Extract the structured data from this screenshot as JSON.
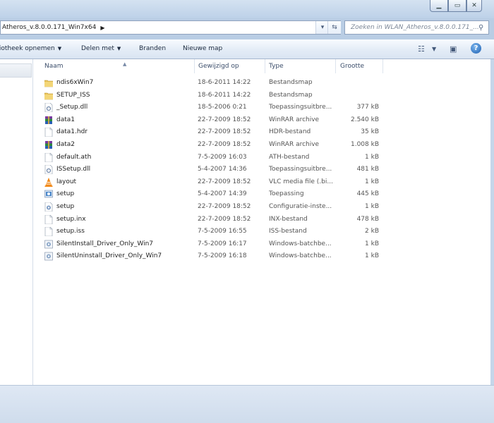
{
  "window": {
    "address_path": "Atheros_v.8.0.0.171_Win7x64",
    "search_placeholder": "Zoeken in WLAN_Atheros_v.8.0.0.171_..."
  },
  "toolbar": {
    "library": "Bibliotheek opnemen",
    "share": "Delen met",
    "burn": "Branden",
    "new_folder": "Nieuwe map",
    "help": "?"
  },
  "columns": {
    "name": "Naam",
    "date": "Gewijzigd op",
    "type": "Type",
    "size": "Grootte"
  },
  "files": [
    {
      "name": "ndis6xWin7",
      "date": "18-6-2011 14:22",
      "type": "Bestandsmap",
      "size": "",
      "icon": "folder-icon"
    },
    {
      "name": "SETUP_ISS",
      "date": "18-6-2011 14:22",
      "type": "Bestandsmap",
      "size": "",
      "icon": "folder-icon"
    },
    {
      "name": "_Setup.dll",
      "date": "18-5-2006 0:21",
      "type": "Toepassingsuitbre...",
      "size": "377 kB",
      "icon": "dll-icon"
    },
    {
      "name": "data1",
      "date": "22-7-2009 18:52",
      "type": "WinRAR archive",
      "size": "2.540 kB",
      "icon": "winrar-icon"
    },
    {
      "name": "data1.hdr",
      "date": "22-7-2009 18:52",
      "type": "HDR-bestand",
      "size": "35 kB",
      "icon": "file-icon"
    },
    {
      "name": "data2",
      "date": "22-7-2009 18:52",
      "type": "WinRAR archive",
      "size": "1.008 kB",
      "icon": "winrar-icon"
    },
    {
      "name": "default.ath",
      "date": "7-5-2009 16:03",
      "type": "ATH-bestand",
      "size": "1 kB",
      "icon": "file-icon"
    },
    {
      "name": "ISSetup.dll",
      "date": "5-4-2007 14:36",
      "type": "Toepassingsuitbre...",
      "size": "481 kB",
      "icon": "dll-icon"
    },
    {
      "name": "layout",
      "date": "22-7-2009 18:52",
      "type": "VLC media file (.bi...",
      "size": "1 kB",
      "icon": "vlc-icon"
    },
    {
      "name": "setup",
      "date": "5-4-2007 14:39",
      "type": "Toepassing",
      "size": "445 kB",
      "icon": "setup-icon"
    },
    {
      "name": "setup",
      "date": "22-7-2009 18:52",
      "type": "Configuratie-inste...",
      "size": "1 kB",
      "icon": "config-icon"
    },
    {
      "name": "setup.inx",
      "date": "22-7-2009 18:52",
      "type": "INX-bestand",
      "size": "478 kB",
      "icon": "file-icon"
    },
    {
      "name": "setup.iss",
      "date": "7-5-2009 16:55",
      "type": "ISS-bestand",
      "size": "2 kB",
      "icon": "file-icon"
    },
    {
      "name": "SilentInstall_Driver_Only_Win7",
      "date": "7-5-2009 16:17",
      "type": "Windows-batchbe...",
      "size": "1 kB",
      "icon": "batch-icon"
    },
    {
      "name": "SilentUninstall_Driver_Only_Win7",
      "date": "7-5-2009 16:18",
      "type": "Windows-batchbe...",
      "size": "1 kB",
      "icon": "batch-icon"
    }
  ]
}
